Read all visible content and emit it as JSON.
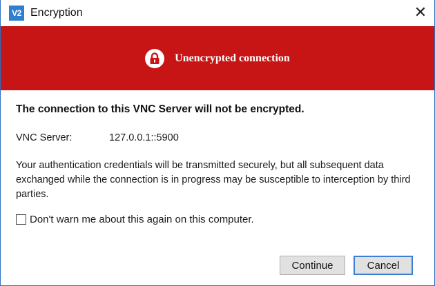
{
  "window": {
    "app_icon_text": "V2",
    "title": "Encryption",
    "close_symbol": "✕"
  },
  "banner": {
    "icon": "lock-icon",
    "text": "Unencrypted connection",
    "color": "#c71414"
  },
  "body": {
    "headline": "The connection to this VNC Server will not be encrypted.",
    "server_label": "VNC Server:",
    "server_value": "127.0.0.1::5900",
    "description": "Your authentication credentials will be transmitted securely, but all subsequent data exchanged while the connection is in progress may be susceptible to interception by third parties.",
    "checkbox_label": "Don't warn me about this again on this computer.",
    "checkbox_checked": false
  },
  "buttons": {
    "continue_label": "Continue",
    "cancel_label": "Cancel"
  }
}
